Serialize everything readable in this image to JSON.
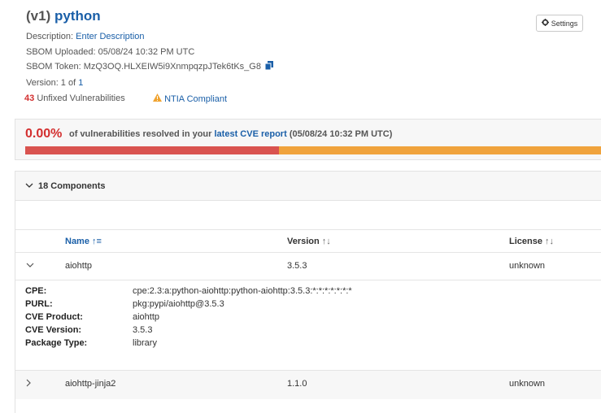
{
  "sbom": {
    "version_tag": "(v1)",
    "name": "python",
    "description_label": "Description:",
    "description_link": "Enter Description",
    "uploaded": "SBOM Uploaded: 05/08/24 10:32 PM UTC",
    "token": "SBOM Token: MzQ3OQ.HLXEIW5i9XnmpqzpJTek6tKs_G8",
    "version_label": "Version: 1 of",
    "version_link": "1"
  },
  "settings_label": "Settings",
  "vulns": {
    "count": "43",
    "label": "Unfixed Vulnerabilities",
    "ntia_icon": "warning-icon",
    "ntia_label": "NTIA Compliant"
  },
  "report": {
    "percent": "0.00%",
    "text_prefix": "of vulnerabilities resolved in your",
    "link": "latest CVE report",
    "date": "(05/08/24 10:32 PM UTC)",
    "resolved_fraction": 0.44
  },
  "components": {
    "header": "18 Components",
    "columns": [
      {
        "label": "Name",
        "sort": "↑≡"
      },
      {
        "label": "Version",
        "sort": "↑↓"
      },
      {
        "label": "License",
        "sort": "↑↓"
      }
    ],
    "rows": [
      {
        "name": "aiohttp",
        "version": "3.5.3",
        "license": "unknown",
        "expanded": true
      },
      {
        "name": "aiohttp-jinja2",
        "version": "1.1.0",
        "license": "unknown",
        "expanded": false
      }
    ],
    "details": [
      {
        "label": "CPE:",
        "value": "cpe:2.3:a:python-aiohttp:python-aiohttp:3.5.3:*:*:*:*:*:*:*"
      },
      {
        "label": "PURL:",
        "value": "pkg:pypi/aiohttp@3.5.3"
      },
      {
        "label": "CVE Product:",
        "value": "aiohttp"
      },
      {
        "label": "CVE Version:",
        "value": "3.5.3"
      },
      {
        "label": "Package Type:",
        "value": "library"
      }
    ]
  },
  "colors": {
    "accent": "#1a5fa8",
    "danger": "#d32f2f",
    "warning": "#f0a33c"
  }
}
